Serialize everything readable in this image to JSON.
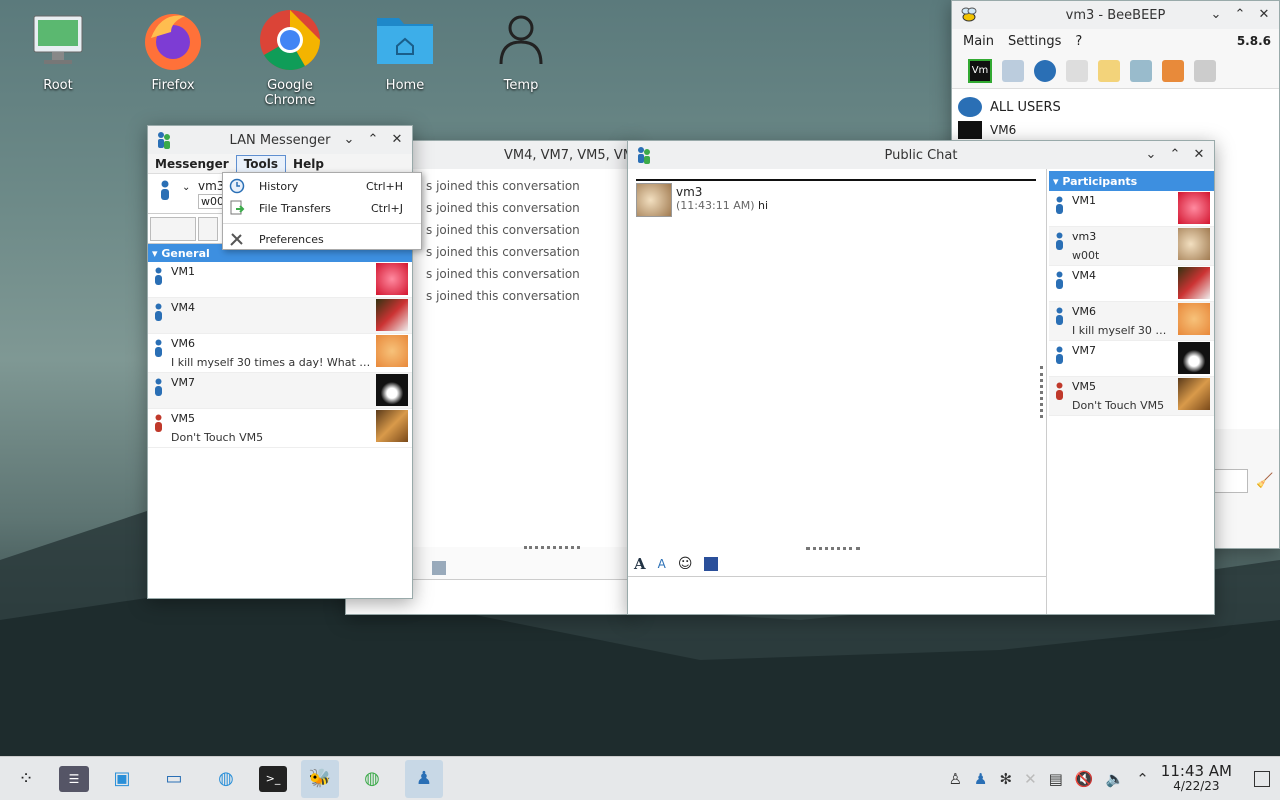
{
  "desktop": {
    "icons": [
      {
        "label": "Root",
        "name": "root-computer-icon"
      },
      {
        "label": "Firefox",
        "name": "firefox-icon"
      },
      {
        "label": "Google Chrome",
        "name": "chrome-icon"
      },
      {
        "label": "Home",
        "name": "home-folder-icon"
      },
      {
        "label": "Temp",
        "name": "temp-user-icon"
      }
    ]
  },
  "beebeep": {
    "title": "vm3 - BeeBEEP",
    "menu": [
      "Main",
      "Settings",
      "?"
    ],
    "version": "5.8.6",
    "all_users": "ALL USERS",
    "vm6": "VM6"
  },
  "lan": {
    "title": "LAN Messenger",
    "menu": {
      "messenger": "Messenger",
      "tools": "Tools",
      "help": "Help"
    },
    "self": {
      "name": "vm3",
      "status": "w00"
    },
    "group": "General",
    "users": [
      {
        "name": "VM1",
        "status": ""
      },
      {
        "name": "VM4",
        "status": ""
      },
      {
        "name": "VM6",
        "status": "I kill myself 30 times a day! What ab..."
      },
      {
        "name": "VM7",
        "status": ""
      },
      {
        "name": "VM5",
        "status": "Don't Touch VM5"
      }
    ]
  },
  "tools_menu": [
    {
      "label": "History",
      "shortcut": "Ctrl+H"
    },
    {
      "label": "File Transfers",
      "shortcut": "Ctrl+J"
    },
    {
      "label": "Preferences",
      "shortcut": ""
    }
  ],
  "conv": {
    "title": "VM4, VM7, VM5, VM6,",
    "lines": [
      "s joined this conversation",
      "s joined this conversation",
      "s joined this conversation",
      "s joined this conversation",
      "s joined this conversation",
      "s joined this conversation"
    ]
  },
  "public": {
    "title": "Public Chat",
    "msg": {
      "sender": "vm3",
      "time": "(11:43:11 AM)",
      "text": "hi"
    },
    "participants_label": "Participants",
    "participants": [
      {
        "name": "VM1",
        "status": ""
      },
      {
        "name": "vm3",
        "status": "w00t"
      },
      {
        "name": "VM4",
        "status": ""
      },
      {
        "name": "VM6",
        "status": "I kill myself 30 ti..."
      },
      {
        "name": "VM7",
        "status": ""
      },
      {
        "name": "VM5",
        "status": "Don't Touch VM5"
      }
    ]
  },
  "taskbar": {
    "time": "11:43 AM",
    "date": "4/22/23"
  },
  "colors": {
    "accent": "#3d8fe0",
    "online": "#2a6fb5",
    "away": "#c0392b"
  }
}
